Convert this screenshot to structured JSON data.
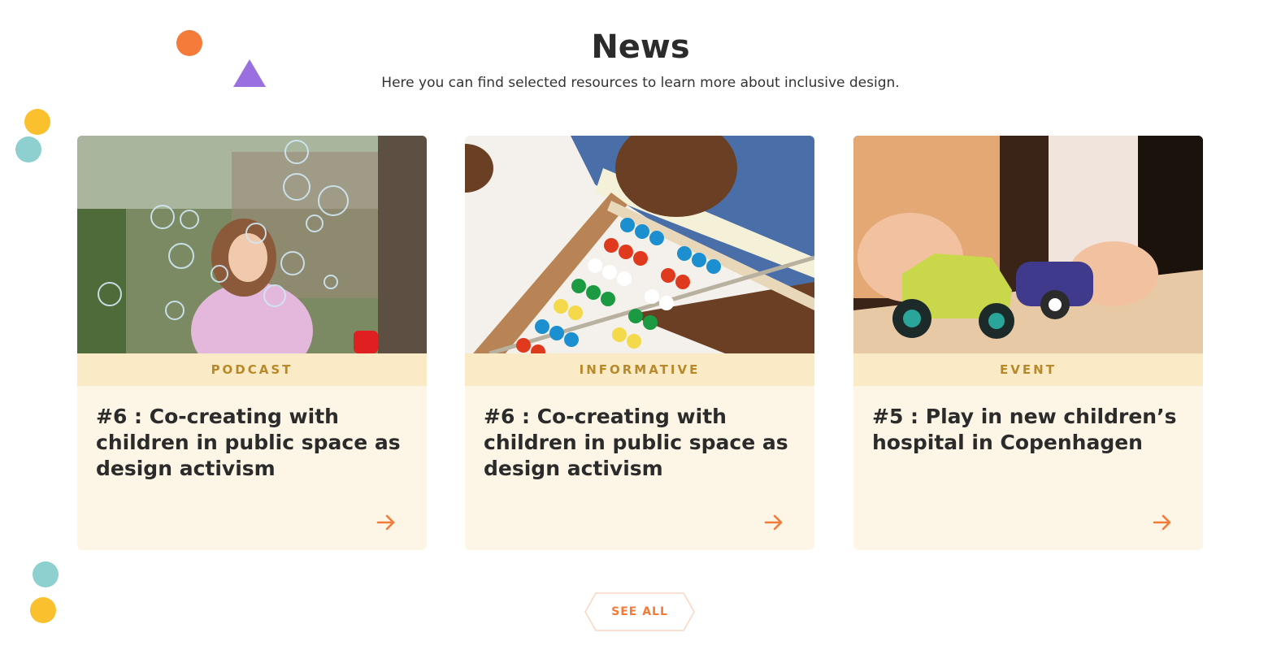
{
  "header": {
    "title": "News",
    "subtitle": "Here you can find selected resources to learn more about inclusive design."
  },
  "cards": [
    {
      "tag": "PODCAST",
      "title": "#6 : Co-creating with children in public space as design activism",
      "image": "photo of child blowing soap bubbles"
    },
    {
      "tag": "INFORMATIVE",
      "title": "#6 : Co-creating with children in public space as design activism",
      "image": "photo of toddler playing with colorful abacus"
    },
    {
      "tag": "EVENT",
      "title": "#5 : Play in new children’s hospital in Copenhagen",
      "image": "photo of child hands playing with toy cars"
    }
  ],
  "actions": {
    "see_all": "SEE ALL"
  },
  "colors": {
    "accent": "#f37b3a",
    "tag_text": "#b8892a",
    "tag_bg": "#faebc6",
    "card_bg": "#fdf6e6",
    "deco_orange": "#f57b3a",
    "deco_purple": "#9a70e0",
    "deco_yellow": "#fbc02d",
    "deco_teal": "#8ecfcf"
  },
  "icons": {
    "card_arrow": "arrow-right-icon"
  }
}
